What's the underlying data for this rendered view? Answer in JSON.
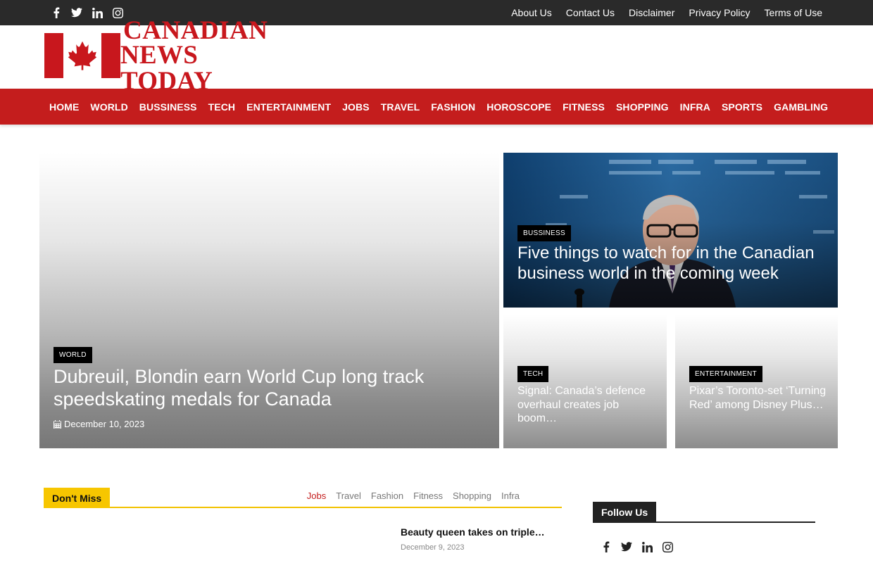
{
  "topbar": {
    "social_icons": [
      "facebook-icon",
      "twitter-icon",
      "linkedin-icon",
      "instagram-icon"
    ],
    "links": [
      "About Us",
      "Contact Us",
      "Disclaimer",
      "Privacy Policy",
      "Terms of Use"
    ]
  },
  "logo": {
    "line1": "CANADIAN",
    "line2": "NEWS TODAY",
    "icon": "maple-leaf-icon"
  },
  "nav": {
    "items": [
      "HOME",
      "WORLD",
      "BUSSINESS",
      "TECH",
      "ENTERTAINMENT",
      "JOBS",
      "TRAVEL",
      "FASHION",
      "HOROSCOPE",
      "FITNESS",
      "SHOPPING",
      "INFRA",
      "SPORTS",
      "GAMBLING"
    ]
  },
  "featured": {
    "main": {
      "category": "WORLD",
      "title": "Dubreuil, Blondin earn World Cup long track speedskating medals for Canada",
      "date": "December 10, 2023"
    },
    "top_right": {
      "category": "BUSSINESS",
      "title": "Five things to watch for in the Canadian business world in the coming week"
    },
    "small_a": {
      "category": "TECH",
      "title": "Signal: Canada’s defence overhaul creates job boom…"
    },
    "small_b": {
      "category": "ENTERTAINMENT",
      "title": "Pixar’s Toronto-set ‘Turning Red’ among Disney Plus…"
    }
  },
  "dont_miss": {
    "label": "Don't Miss",
    "tabs": [
      "Jobs",
      "Travel",
      "Fashion",
      "Fitness",
      "Shopping",
      "Infra"
    ],
    "active_tab": "Jobs",
    "item": {
      "title": "Beauty queen takes on triple…",
      "date": "December 9, 2023"
    }
  },
  "follow_us": {
    "label": "Follow Us",
    "icons": [
      "facebook-icon",
      "twitter-icon",
      "linkedin-icon",
      "instagram-icon"
    ]
  },
  "colors": {
    "topbar": "#2a2a2a",
    "nav": "#c41d1d",
    "brand_red": "#c8171d",
    "dont_miss_accent": "#f7c600",
    "active_tab": "#c41d1d"
  }
}
